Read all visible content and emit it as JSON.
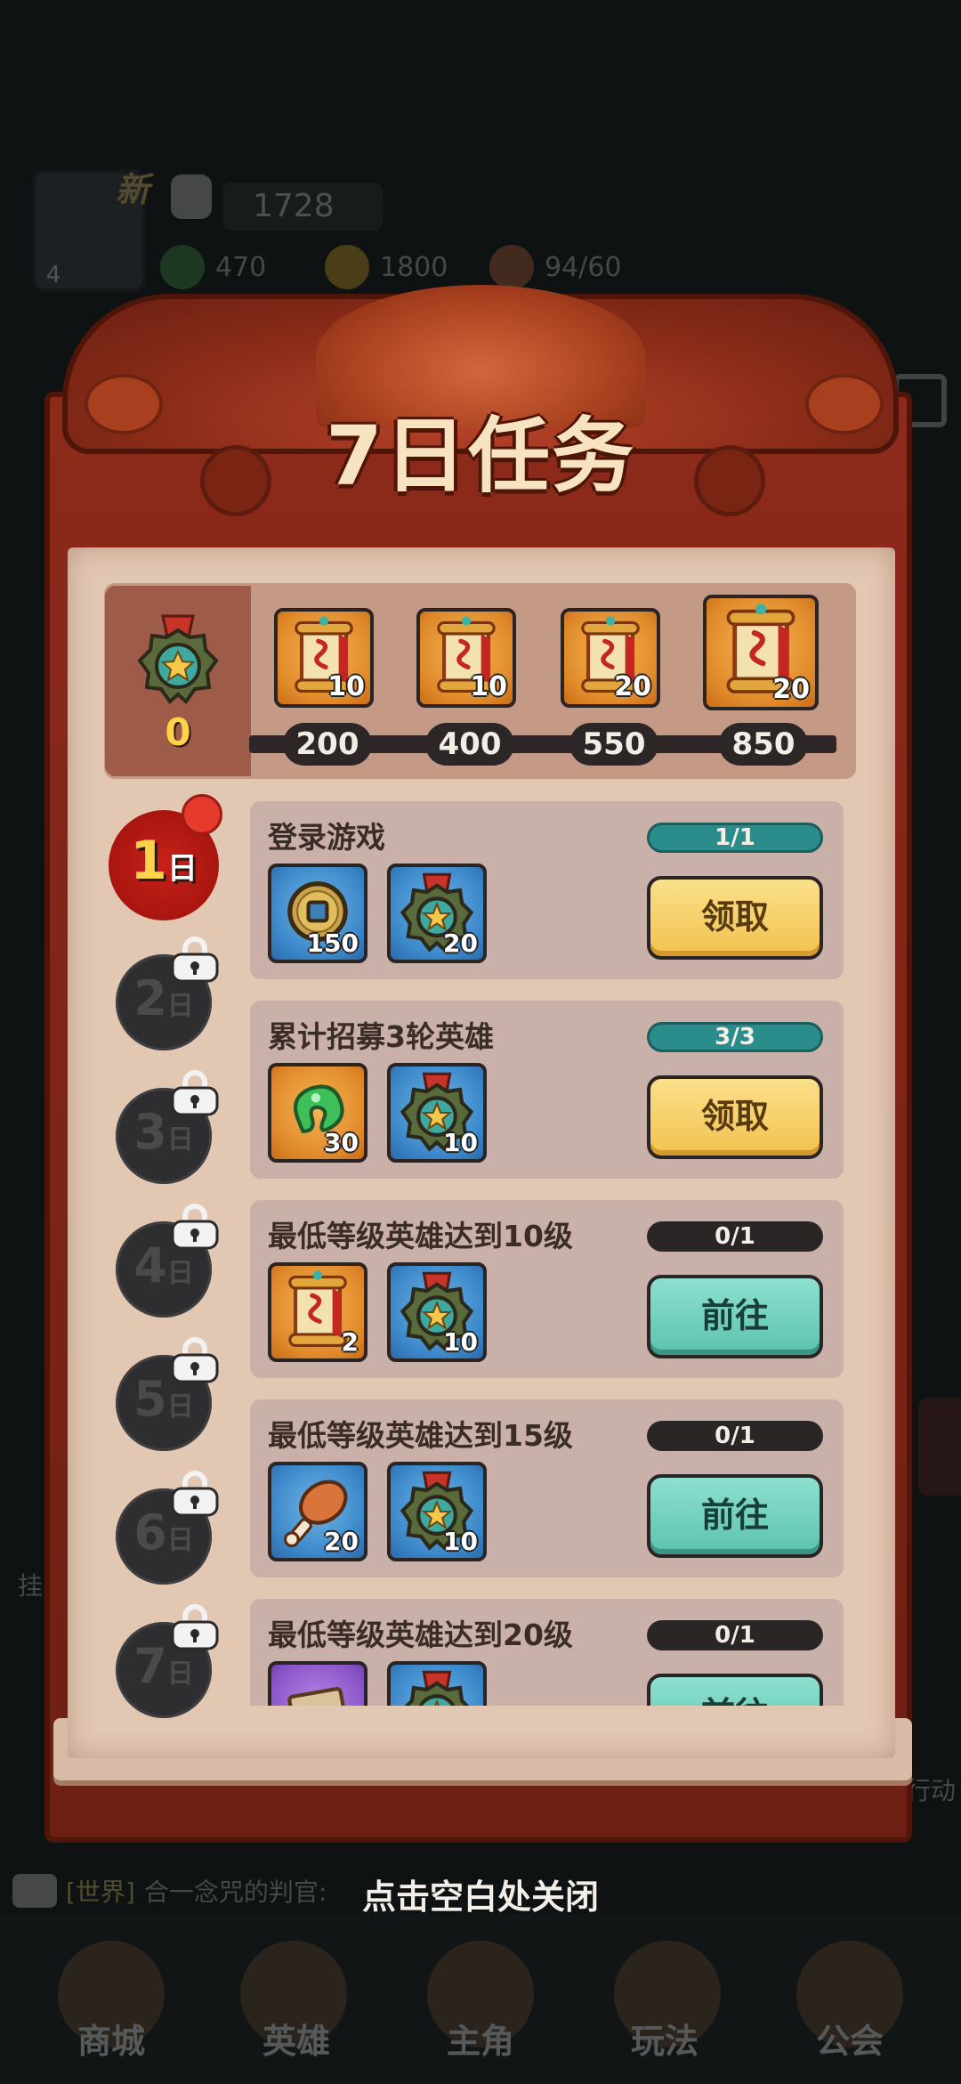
{
  "background": {
    "avatar_level": "4",
    "new_badge": "新",
    "power": "1728",
    "resources": [
      {
        "icon": "green-gem-icon",
        "value": "470"
      },
      {
        "icon": "gold-coin-icon",
        "value": "1800"
      },
      {
        "icon": "drumstick-icon",
        "value": "94/60"
      }
    ],
    "side_left_label": "挂",
    "side_right_label": "行动",
    "chat": {
      "tag": "[世界]",
      "text": "合一念咒的判官: "
    },
    "nav": [
      "商城",
      "英雄",
      "主角",
      "玩法",
      "公会"
    ]
  },
  "panel": {
    "title": "7日任务",
    "close_hint": "点击空白处关闭"
  },
  "milestones": {
    "current_points": "0",
    "rewards": [
      {
        "icon": "scroll-icon",
        "qty": "10",
        "threshold": "200"
      },
      {
        "icon": "scroll-icon",
        "qty": "10",
        "threshold": "400"
      },
      {
        "icon": "scroll-icon",
        "qty": "20",
        "threshold": "550"
      },
      {
        "icon": "scroll-icon",
        "qty": "20",
        "threshold": "850"
      }
    ]
  },
  "days": [
    {
      "num": "1",
      "suffix": "日",
      "state": "active"
    },
    {
      "num": "2",
      "suffix": "日",
      "state": "locked"
    },
    {
      "num": "3",
      "suffix": "日",
      "state": "locked"
    },
    {
      "num": "4",
      "suffix": "日",
      "state": "locked"
    },
    {
      "num": "5",
      "suffix": "日",
      "state": "locked"
    },
    {
      "num": "6",
      "suffix": "日",
      "state": "locked"
    },
    {
      "num": "7",
      "suffix": "日",
      "state": "locked"
    }
  ],
  "tasks": [
    {
      "title": "登录游戏",
      "progress": "1/1",
      "button": "领取",
      "state": "claim",
      "rewards": [
        {
          "icon": "copper-coin-icon",
          "qty": "150"
        },
        {
          "icon": "medal-icon",
          "qty": "20"
        }
      ]
    },
    {
      "title": "累计招募3轮英雄",
      "progress": "3/3",
      "button": "领取",
      "state": "claim",
      "rewards": [
        {
          "icon": "green-jade-icon",
          "qty": "30"
        },
        {
          "icon": "medal-icon",
          "qty": "10"
        }
      ]
    },
    {
      "title": "最低等级英雄达到10级",
      "progress": "0/1",
      "button": "前往",
      "state": "go",
      "rewards": [
        {
          "icon": "scroll-icon",
          "qty": "2"
        },
        {
          "icon": "medal-icon",
          "qty": "10"
        }
      ]
    },
    {
      "title": "最低等级英雄达到15级",
      "progress": "0/1",
      "button": "前往",
      "state": "go",
      "rewards": [
        {
          "icon": "drumstick-icon",
          "qty": "20"
        },
        {
          "icon": "medal-icon",
          "qty": "10"
        }
      ]
    },
    {
      "title": "最低等级英雄达到20级",
      "progress": "0/1",
      "button": "前往",
      "state": "go",
      "rewards": [
        {
          "icon": "purple-scroll-icon",
          "qty": ""
        },
        {
          "icon": "medal-icon",
          "qty": ""
        }
      ]
    }
  ],
  "colors": {
    "frame_red": "#8d2a1b",
    "paper": "#e2c7b3",
    "claim_yellow": "#f2c24f",
    "go_teal": "#5cc2af",
    "progress_done": "#2b8c8c",
    "points_gold": "#ffd24a"
  }
}
